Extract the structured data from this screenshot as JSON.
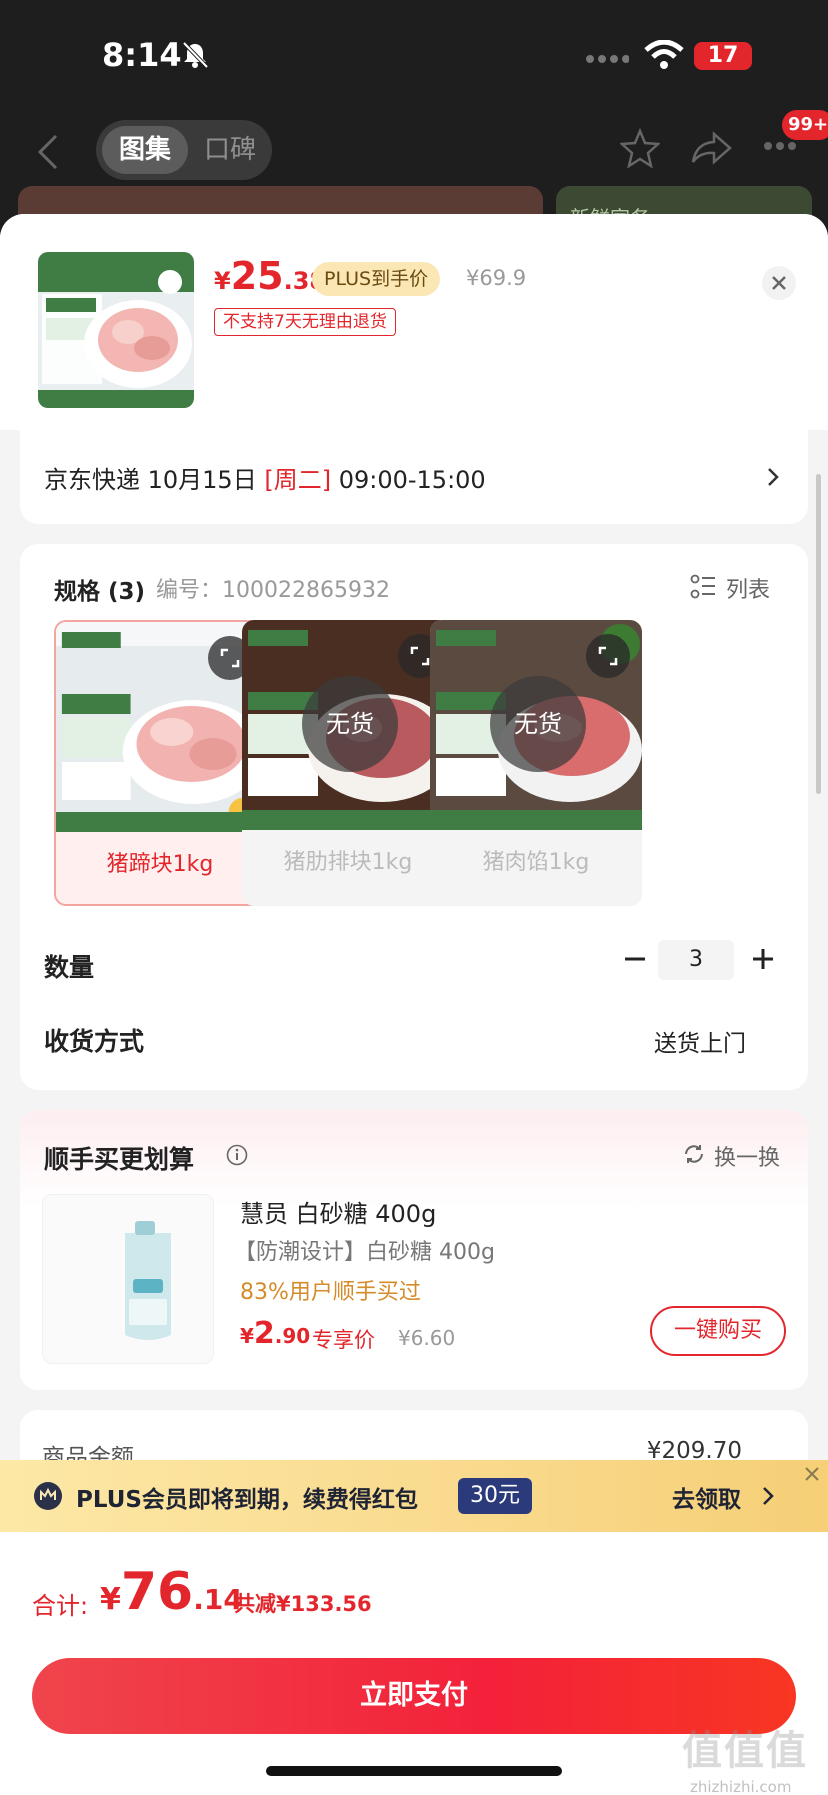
{
  "status_bar": {
    "time": "8:14",
    "battery": "17"
  },
  "bg_nav": {
    "tab_active": "图集",
    "tab_inactive": "口碑",
    "badge": "99+",
    "bg_tag": "新鲜家务"
  },
  "product": {
    "price_currency": "¥",
    "price_int": "25",
    "price_dec": ".38",
    "plus_tag": "PLUS到手价",
    "original_price": "¥69.9",
    "return_policy": "不支持7天无理由退货"
  },
  "delivery": {
    "prefix": "京东快递 10月15日 ",
    "weekday": "[周二]",
    "time": " 09:00-15:00"
  },
  "spec": {
    "title": "规格 (3)",
    "code": "编号：100022865932",
    "list_label": "列表",
    "out_of_stock": "无货",
    "options": [
      {
        "name": "猪蹄块1kg"
      },
      {
        "name": "猪肋排块1kg"
      },
      {
        "name": "猪肉馅1kg"
      }
    ]
  },
  "quantity": {
    "label": "数量",
    "value": "3"
  },
  "shipping": {
    "label": "收货方式",
    "value": "送货上门"
  },
  "upsell": {
    "title": "顺手买更划算",
    "swap_label": "换一换",
    "name": "慧员 白砂糖 400g",
    "desc": "【防潮设计】白砂糖 400g",
    "stat": "83%用户顺手买过",
    "price_currency": "¥",
    "price_int": "2",
    "price_dec": ".90",
    "price_label": "专享价",
    "original_price": "¥6.60",
    "buy_label": "一键购买"
  },
  "amount": {
    "label": "商品金额",
    "value": "¥209.70"
  },
  "plus_banner": {
    "text": "PLUS会员即将到期，续费得红包",
    "coupon": "30元",
    "link": "去领取"
  },
  "footer": {
    "total_label": "合计:",
    "total_currency": "¥",
    "total_int": "76",
    "total_dec": ".14",
    "saving": "共减¥133.56",
    "pay_label": "立即支付"
  },
  "watermark": {
    "main": "值值值",
    "sub": "zhizhizhi.com"
  },
  "colors": {
    "accent": "#e3262c",
    "plus_gold": "#fbe7b4",
    "stat_orange": "#d58b2a"
  }
}
